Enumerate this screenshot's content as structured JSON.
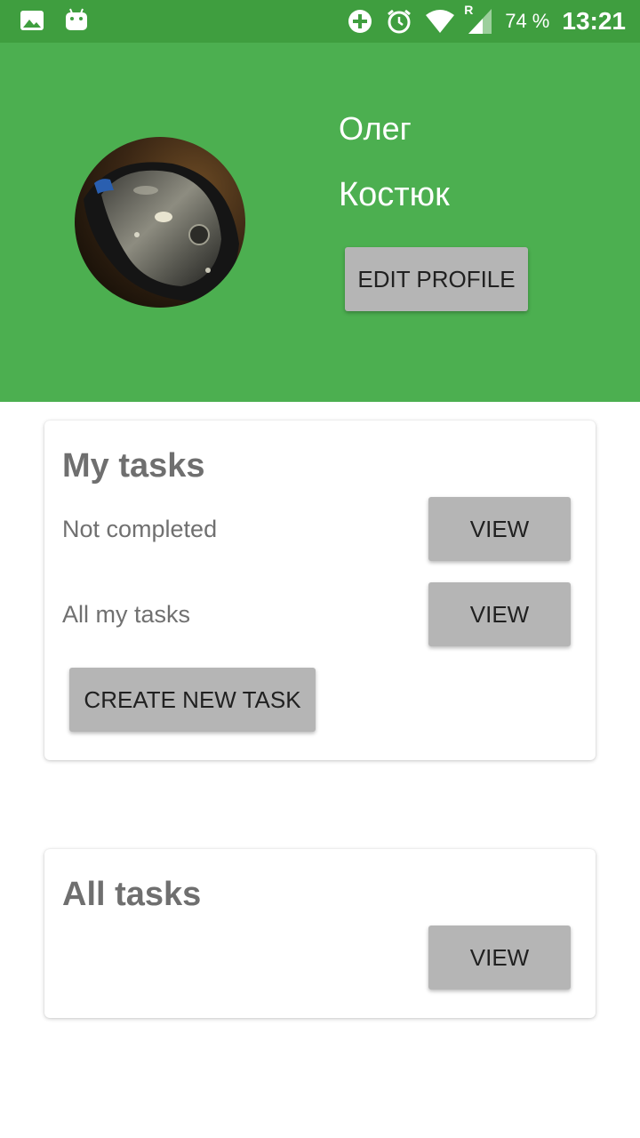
{
  "status_bar": {
    "icons_left": [
      "image-icon",
      "android-icon"
    ],
    "icons_right": [
      "add-circle-icon",
      "alarm-icon",
      "wifi-icon",
      "signal-icon"
    ],
    "roaming": "R",
    "battery": "74 %",
    "time": "13:21"
  },
  "profile": {
    "first_name": "Олег",
    "last_name": "Костюк",
    "edit_label": "EDIT PROFILE"
  },
  "my_tasks": {
    "title": "My tasks",
    "rows": [
      {
        "label": "Not completed",
        "button": "VIEW"
      },
      {
        "label": "All my tasks",
        "button": "VIEW"
      }
    ],
    "create_label": "CREATE NEW TASK"
  },
  "all_tasks": {
    "title": "All tasks",
    "button": "VIEW"
  },
  "colors": {
    "status_bar": "#3f9e3f",
    "header": "#4caf50",
    "button": "#b5b5b5",
    "title_text": "#6f6f6f"
  }
}
